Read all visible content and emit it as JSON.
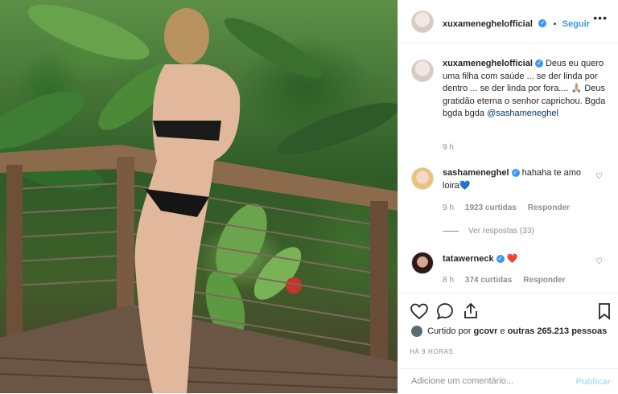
{
  "header": {
    "username": "xuxameneghelofficial",
    "separator": "•",
    "follow_label": "Seguir",
    "more_icon": "more-dots-icon"
  },
  "caption": {
    "username": "xuxameneghelofficial",
    "text_1": "Deus eu quero uma filha com saúde ... se der linda por dentro ... se der linda por fora....",
    "emoji": "🙏🏼",
    "text_2": "Deus gratidão eterna o senhor caprichou. Bgda bgda bgda",
    "mention": "@sashameneghel",
    "time": "9 h"
  },
  "comments": [
    {
      "username": "sashameneghel",
      "text": "hahaha te amo loira",
      "emoji": "💙",
      "time": "9 h",
      "likes": "1923 curtidas",
      "reply_label": "Responder",
      "view_replies": "Ver respostas (33)"
    },
    {
      "username": "tatawerneck",
      "text": "",
      "emoji": "❤️",
      "time": "8 h",
      "likes": "374 curtidas",
      "reply_label": "Responder"
    }
  ],
  "liked_by": {
    "prefix": "Curtido por",
    "user": "gcovr",
    "middle": "e",
    "others": "outras 265.213 pessoas"
  },
  "timestamp": "HÁ 9 HORAS",
  "add_comment": {
    "placeholder": "Adicione um comentário...",
    "publish_label": "Publicar"
  },
  "colors": {
    "accent": "#3897f0",
    "text": "#262626",
    "muted": "#8e8e8e",
    "publish_disabled": "#b2dffc",
    "mention": "#003569"
  }
}
